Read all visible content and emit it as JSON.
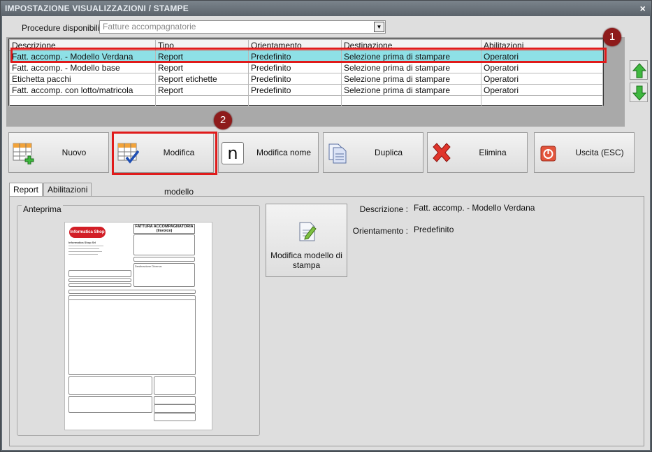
{
  "window": {
    "title": "IMPOSTAZIONE VISUALIZZAZIONI / STAMPE",
    "close_glyph": "×"
  },
  "procedures": {
    "label": "Procedure disponibili :",
    "value": "Fatture accompagnatorie"
  },
  "grid": {
    "columns": [
      "Descrizione",
      "Tipo",
      "Orientamento",
      "Destinazione",
      "Abilitazioni"
    ],
    "rows": [
      [
        "Fatt. accomp. - Modello Verdana",
        "Report",
        "Predefinito",
        "Selezione prima di stampare",
        "Operatori"
      ],
      [
        "Fatt. accomp. - Modello base",
        "Report",
        "Predefinito",
        "Selezione prima di stampare",
        "Operatori"
      ],
      [
        "Etichetta pacchi",
        "Report etichette",
        "Predefinito",
        "Selezione prima di stampare",
        "Operatori"
      ],
      [
        "Fatt. accomp. con lotto/matricola",
        "Report",
        "Predefinito",
        "Selezione prima di stampare",
        "Operatori"
      ]
    ],
    "selected_row": 0
  },
  "callouts": {
    "one": "1",
    "two": "2"
  },
  "toolbar": {
    "nuovo": "Nuovo",
    "modifica_modello": "Modifica modello",
    "modifica_nome": "Modifica nome",
    "duplica": "Duplica",
    "elimina": "Elimina",
    "uscita": "Uscita (ESC)",
    "nome_glyph": "n"
  },
  "tabs": {
    "report": "Report",
    "abilitazioni": "Abilitazioni"
  },
  "preview": {
    "title": "Anteprima",
    "logo_text": "Informatica Shop",
    "doc_title_1": "FATTURA ACCOMPAGNATORIA",
    "doc_title_2": "(Invoice)",
    "company": "Informatica Shop Srl",
    "dest_label": "Destinazione Diversa:"
  },
  "modifica_stampa": {
    "label": "Modifica modello di stampa"
  },
  "info": {
    "descrizione_label": "Descrizione :",
    "descrizione_value": "Fatt. accomp. - Modello Verdana",
    "orientamento_label": "Orientamento :",
    "orientamento_value": "Predefinito"
  },
  "colors": {
    "selected_row": "#8ee0e6",
    "highlight": "#e01b1b",
    "badge": "#8e1b1b"
  },
  "icons": [
    "close-icon",
    "dropdown-arrow-icon",
    "move-up-icon",
    "move-down-icon",
    "new-grid-icon",
    "edit-grid-icon",
    "rename-icon",
    "duplicate-icon",
    "delete-icon",
    "exit-icon",
    "edit-document-icon"
  ]
}
